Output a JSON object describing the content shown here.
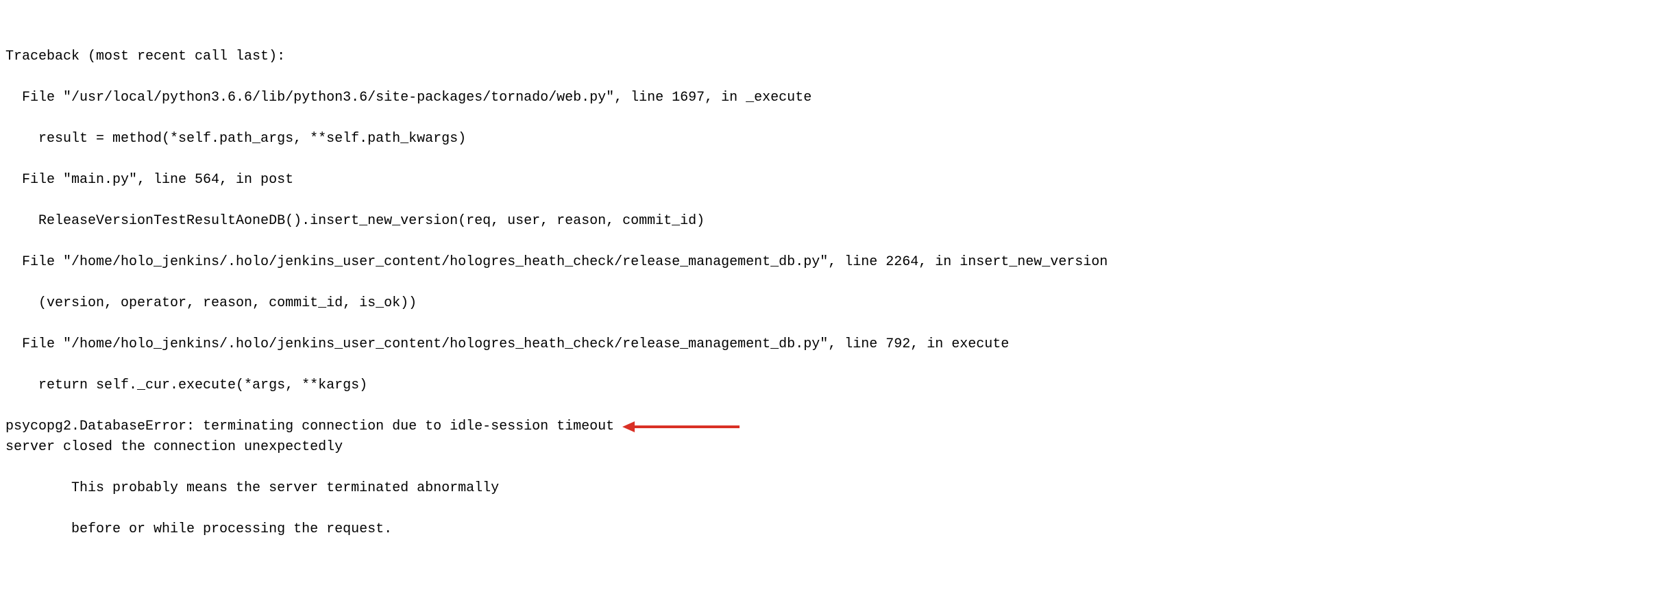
{
  "traceback": {
    "lines": [
      "Traceback (most recent call last):",
      "  File \"/usr/local/python3.6.6/lib/python3.6/site-packages/tornado/web.py\", line 1697, in _execute",
      "    result = method(*self.path_args, **self.path_kwargs)",
      "  File \"main.py\", line 564, in post",
      "    ReleaseVersionTestResultAoneDB().insert_new_version(req, user, reason, commit_id)",
      "  File \"/home/holo_jenkins/.holo/jenkins_user_content/hologres_heath_check/release_management_db.py\", line 2264, in insert_new_version",
      "    (version, operator, reason, commit_id, is_ok))",
      "  File \"/home/holo_jenkins/.holo/jenkins_user_content/hologres_heath_check/release_management_db.py\", line 792, in execute",
      "    return self._cur.execute(*args, **kargs)"
    ],
    "error_line": "psycopg2.DatabaseError: terminating connection due to idle-session timeout",
    "tail_lines": [
      "server closed the connection unexpectedly",
      "        This probably means the server terminated abnormally",
      "        before or while processing the request."
    ]
  },
  "annotation": {
    "arrow_color": "#d93025"
  }
}
